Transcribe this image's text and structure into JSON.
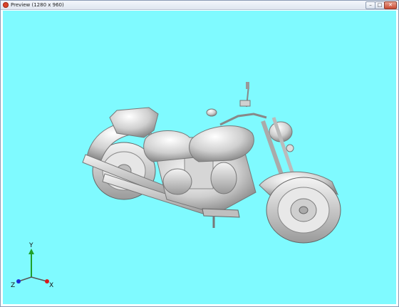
{
  "window": {
    "title": "Preview (1280 x 960)",
    "controls": {
      "minimize": "–",
      "maximize": "□",
      "close": "✕"
    }
  },
  "viewport": {
    "background_color": "#7ffaff",
    "model": "motorcycle-3d-model"
  },
  "axes": {
    "x_label": "X",
    "y_label": "Y",
    "z_label": "Z",
    "x_color": "#d81b1b",
    "y_color": "#1fa12a",
    "z_color": "#1c2fd6"
  }
}
